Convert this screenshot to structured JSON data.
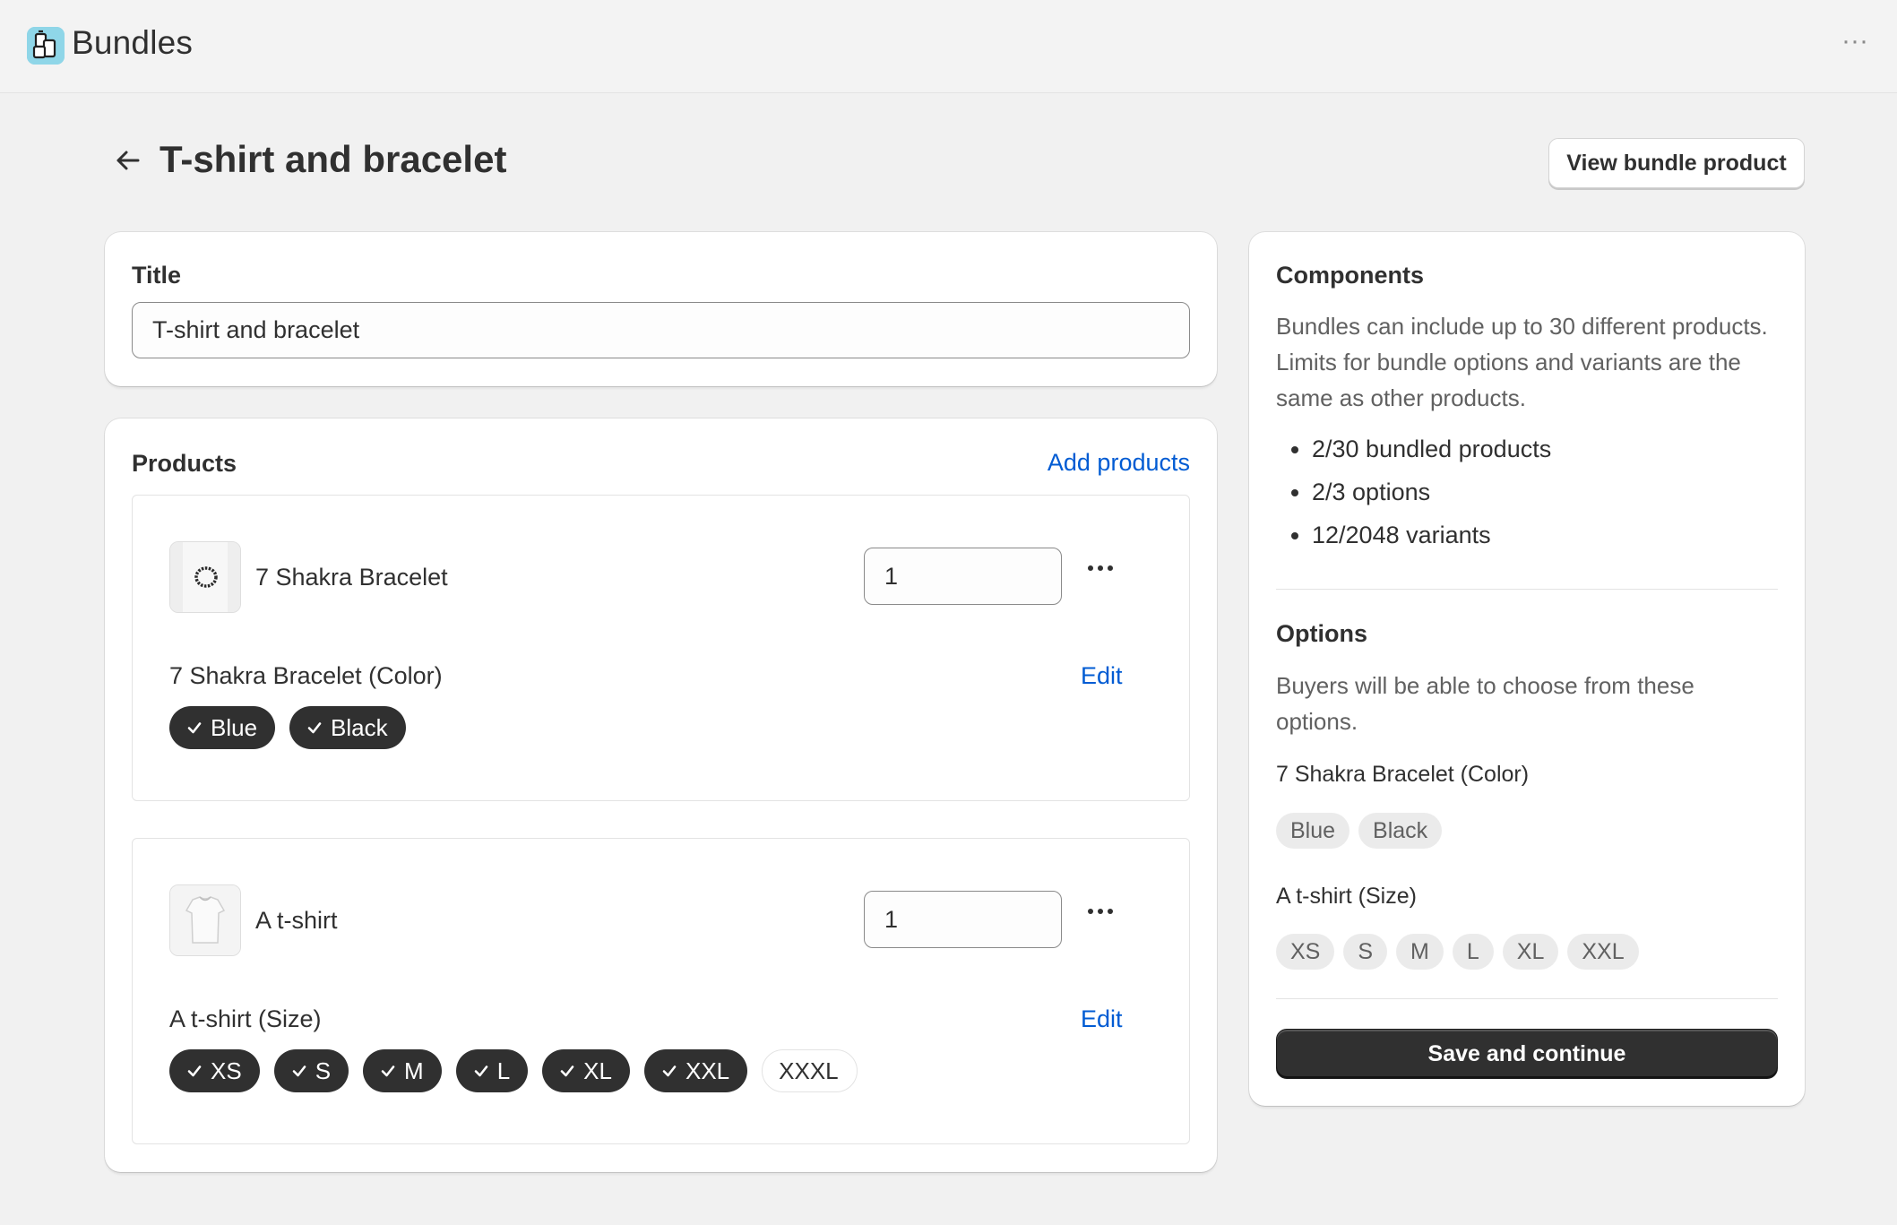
{
  "app": {
    "title": "Bundles",
    "logo_icon": "bundles-app-icon",
    "more_icon": "ellipsis-icon"
  },
  "page": {
    "back_icon": "arrow-left-icon",
    "title": "T-shirt and bracelet",
    "view_bundle_label": "View bundle product"
  },
  "title_card": {
    "label": "Title",
    "value": "T-shirt and bracelet"
  },
  "products_card": {
    "label": "Products",
    "add_label": "Add products",
    "items": [
      {
        "name": "7 Shakra Bracelet",
        "quantity": "1",
        "thumb_icon": "bracelet-image",
        "option_title": "7 Shakra Bracelet (Color)",
        "edit_label": "Edit",
        "values": [
          {
            "label": "Blue",
            "selected": true
          },
          {
            "label": "Black",
            "selected": true
          }
        ]
      },
      {
        "name": "A t-shirt",
        "quantity": "1",
        "thumb_icon": "tshirt-image",
        "option_title": "A t-shirt (Size)",
        "edit_label": "Edit",
        "values": [
          {
            "label": "XS",
            "selected": true
          },
          {
            "label": "S",
            "selected": true
          },
          {
            "label": "M",
            "selected": true
          },
          {
            "label": "L",
            "selected": true
          },
          {
            "label": "XL",
            "selected": true
          },
          {
            "label": "XXL",
            "selected": true
          },
          {
            "label": "XXXL",
            "selected": false
          }
        ]
      }
    ]
  },
  "side": {
    "components_title": "Components",
    "components_desc": "Bundles can include up to 30 different products. Limits for bundle options and variants are the same as other products.",
    "limits": [
      "2/30 bundled products",
      "2/3 options",
      "12/2048 variants"
    ],
    "options_title": "Options",
    "options_desc": "Buyers will be able to choose from these options.",
    "option_groups": [
      {
        "label": "7 Shakra Bracelet (Color)",
        "values": [
          "Blue",
          "Black"
        ]
      },
      {
        "label": "A t-shirt (Size)",
        "values": [
          "XS",
          "S",
          "M",
          "L",
          "XL",
          "XXL"
        ]
      }
    ],
    "save_label": "Save and continue"
  },
  "colors": {
    "accent_link": "#005bd3",
    "chip_selected": "#303030",
    "background": "#f1f1f1"
  }
}
